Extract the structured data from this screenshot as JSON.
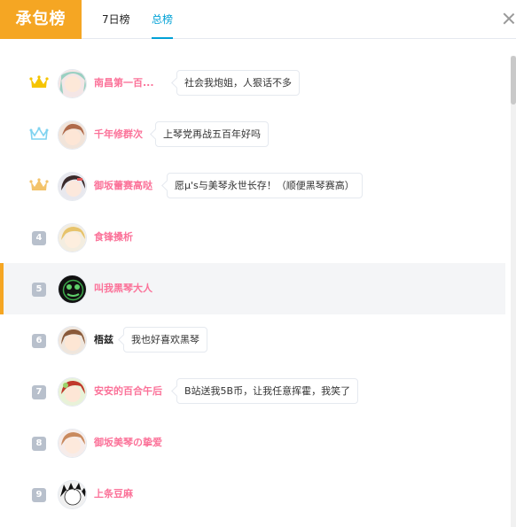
{
  "header": {
    "title": "承包榜",
    "tabs": [
      {
        "label": "7日榜"
      },
      {
        "label": "总榜"
      }
    ],
    "active_tab": "总榜"
  },
  "colors": {
    "accent": "#f5a623",
    "tab_active": "#00a1d6",
    "username": "#fb7299",
    "crown_gold": "#f5c400",
    "crown_silver": "#7fd3f0",
    "crown_bronze": "#f3c36b",
    "rank_badge": "#b8c0cc"
  },
  "list": [
    {
      "rank": "1",
      "badge": "crown-gold-icon",
      "name": "南昌第一百...",
      "message": "社会我炮姐，人狠话不多"
    },
    {
      "rank": "2",
      "badge": "crown-silver-icon",
      "name": "千年修群次",
      "message": "上琴党再战五百年好吗"
    },
    {
      "rank": "3",
      "badge": "crown-bronze-icon",
      "name": "御坂蕾赛高哒",
      "message": "愿μ's与美琴永世长存！（顺便黑琴赛高）"
    },
    {
      "rank": "4",
      "badge": "rank-number",
      "name": "食锋搡析",
      "message": ""
    },
    {
      "rank": "5",
      "badge": "rank-number",
      "name": "叫我黑琴大人",
      "message": ""
    },
    {
      "rank": "6",
      "badge": "rank-number",
      "name": "梧兹",
      "message": "我也好喜欢黑琴"
    },
    {
      "rank": "7",
      "badge": "rank-number",
      "name": "安安的百合午后",
      "message": "B站送我5B币，让我任意挥霍，我笑了"
    },
    {
      "rank": "8",
      "badge": "rank-number",
      "name": "御坂美琴の挚爱",
      "message": ""
    },
    {
      "rank": "9",
      "badge": "rank-number",
      "name": "上条豆麻",
      "message": ""
    }
  ]
}
